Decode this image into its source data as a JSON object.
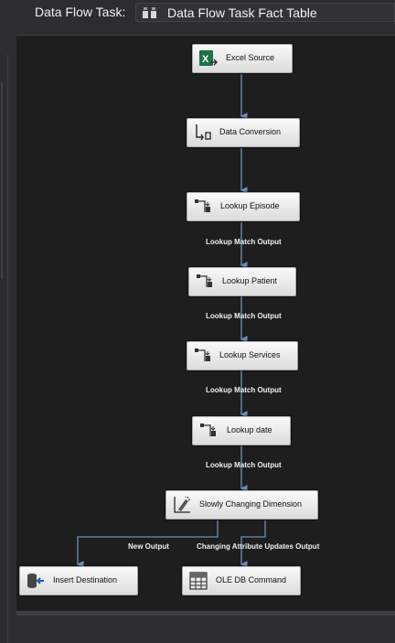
{
  "header": {
    "task_label": "Data Flow Task:",
    "selected_task": "Data Flow Task Fact Table",
    "selected_task_icon": "data-flow-task-icon"
  },
  "components": [
    {
      "label": "Excel Source",
      "icon": "excel-icon"
    },
    {
      "label": "Data Conversion",
      "icon": "data-conversion-icon"
    },
    {
      "label": "Lookup Episode",
      "icon": "lookup-icon"
    },
    {
      "label": "Lookup Patient",
      "icon": "lookup-icon"
    },
    {
      "label": "Lookup Services",
      "icon": "lookup-icon"
    },
    {
      "label": "Lookup date",
      "icon": "lookup-icon"
    },
    {
      "label": "Slowly Changing Dimension",
      "icon": "slowly-changing-dimension-icon"
    },
    {
      "label": "Insert Destination",
      "icon": "destination-icon"
    },
    {
      "label": "OLE DB Command",
      "icon": "ole-db-command-icon"
    }
  ],
  "paths": {
    "lookup_episode_out": "Lookup Match Output",
    "lookup_patient_out": "Lookup Match Output",
    "lookup_services_out": "Lookup Match Output",
    "lookup_date_out": "Lookup Match Output",
    "scd_new": "New Output",
    "scd_changing": "Changing Attribute Updates Output"
  },
  "colors": {
    "canvas": "#1e1e1e",
    "chrome": "#2d2d30",
    "connector": "#6d8fb8",
    "path_label": "#f0f0f0"
  }
}
